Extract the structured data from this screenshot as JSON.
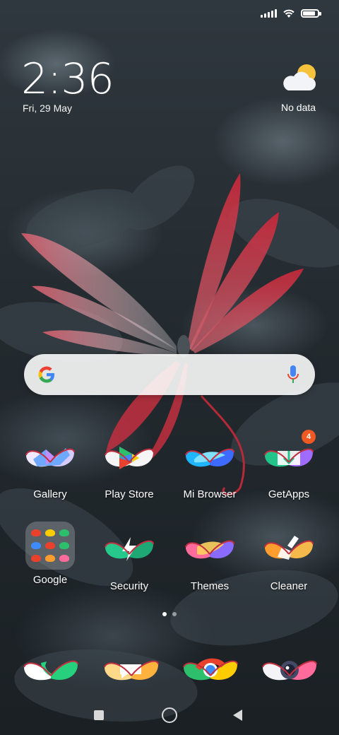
{
  "status_bar": {
    "signal_icon": "signal-icon",
    "wifi_icon": "wifi-icon",
    "battery_icon": "battery-icon",
    "battery_level": 0.85
  },
  "clock_widget": {
    "time": "2:36",
    "date": "Fri, 29 May",
    "weather_icon": "partly-cloudy-icon",
    "weather_text": "No data"
  },
  "search": {
    "logo": "google-g-icon",
    "mic": "microphone-icon"
  },
  "apps": [
    {
      "label": "Gallery",
      "icon": "gallery-icon",
      "colors": [
        "#6ea8ff",
        "#c58cff",
        "#ffffff"
      ]
    },
    {
      "label": "Play Store",
      "icon": "play-store-icon",
      "colors": [
        "#2dbf6c",
        "#ffcc00",
        "#e8412c",
        "#3d8bfd"
      ]
    },
    {
      "label": "Mi Browser",
      "icon": "mi-browser-icon",
      "colors": [
        "#1fb6ff",
        "#3d6bff",
        "#7fe0ff"
      ]
    },
    {
      "label": "GetApps",
      "icon": "getapps-icon",
      "colors": [
        "#22c48a",
        "#a06bff",
        "#ffffff"
      ],
      "badge": "4"
    },
    {
      "label": "Google",
      "icon": "google-folder-icon"
    },
    {
      "label": "Security",
      "icon": "security-icon",
      "colors": [
        "#26c98b",
        "#1ea876",
        "#ffffff"
      ]
    },
    {
      "label": "Themes",
      "icon": "themes-icon",
      "colors": [
        "#ff6b9a",
        "#8a6bff",
        "#ffd25e"
      ]
    },
    {
      "label": "Cleaner",
      "icon": "cleaner-icon",
      "colors": [
        "#ff9d2e",
        "#f5b94b",
        "#ffffff"
      ]
    }
  ],
  "dock": [
    {
      "icon": "phone-icon",
      "colors": [
        "#26d07c",
        "#ffffff"
      ]
    },
    {
      "icon": "messaging-icon",
      "colors": [
        "#ffb23e",
        "#ffffff"
      ]
    },
    {
      "icon": "chrome-icon",
      "colors": [
        "#e8412c",
        "#ffcc00",
        "#2dbf6c",
        "#3d8bfd"
      ]
    },
    {
      "icon": "camera-icon",
      "colors": [
        "#444a66",
        "#ff6b9a",
        "#ffffff"
      ]
    }
  ],
  "page_indicator": {
    "pages": 2,
    "current": 1
  },
  "nav": {
    "recent": "recent-apps-icon",
    "home": "home-icon",
    "back": "back-icon"
  }
}
